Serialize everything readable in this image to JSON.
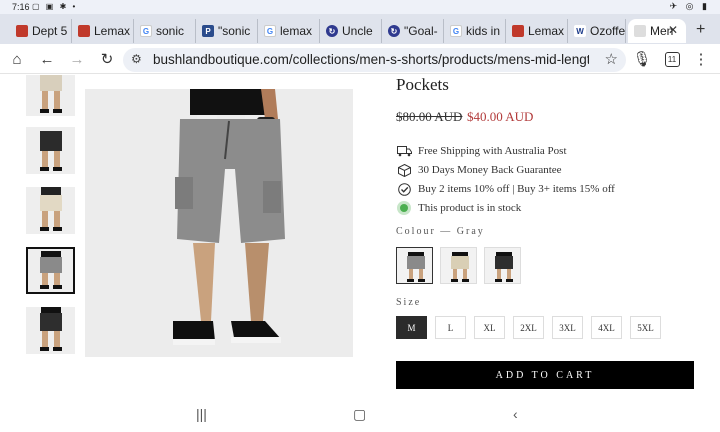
{
  "status": {
    "time": "7:16"
  },
  "tabs": [
    {
      "label": "Dept 5",
      "favicon": "store-favicon",
      "color": "#c0392b"
    },
    {
      "label": "Lemax",
      "favicon": "store-favicon",
      "color": "#c0392b"
    },
    {
      "label": "sonic",
      "favicon": "google-favicon",
      "color": "#4285f4"
    },
    {
      "label": "\"sonic",
      "favicon": "p-favicon",
      "color": "#2b4c8c"
    },
    {
      "label": "lemax",
      "favicon": "google-favicon",
      "color": "#4285f4"
    },
    {
      "label": "Uncle",
      "favicon": "sync-favicon",
      "color": "#2f3a8f"
    },
    {
      "label": "\"Goal-",
      "favicon": "sync-favicon",
      "color": "#2f3a8f"
    },
    {
      "label": "kids in",
      "favicon": "google-favicon",
      "color": "#4285f4"
    },
    {
      "label": "Lemax",
      "favicon": "store-favicon",
      "color": "#c0392b"
    },
    {
      "label": "Ozoffe",
      "favicon": "w-favicon",
      "color": "#1b3a8a"
    },
    {
      "label": "Men",
      "favicon": "page-favicon",
      "color": "#999999"
    }
  ],
  "toolbar": {
    "url": "bushlandboutique.com/collections/men-s-shorts/products/mens-mid-lengt",
    "tab_count": "11"
  },
  "product": {
    "title": "Pockets",
    "old_price": "$80.00 AUD",
    "new_price": "$40.00 AUD",
    "features": [
      {
        "icon": "truck-icon",
        "text": "Free Shipping with Australia Post"
      },
      {
        "icon": "box-icon",
        "text": "30 Days Money Back Guarantee"
      },
      {
        "icon": "check-circle-icon",
        "text": "Buy 2 items 10% off | Buy 3+ items 15% off"
      },
      {
        "icon": "stock-dot-icon",
        "text": "This product is in stock"
      }
    ],
    "colour_label": "Colour — Gray",
    "colours": [
      "Gray",
      "Khaki",
      "Black"
    ],
    "size_label": "Size",
    "sizes": [
      "M",
      "L",
      "XL",
      "2XL",
      "3XL",
      "4XL",
      "5XL"
    ],
    "selected_size": "M",
    "add_to_cart": "ADD TO CART",
    "accent_color": "#b23b3b"
  },
  "thumbnails": [
    "Khaki",
    "Black",
    "Khaki",
    "Gray",
    "Black"
  ],
  "selected_thumbnail": 3
}
